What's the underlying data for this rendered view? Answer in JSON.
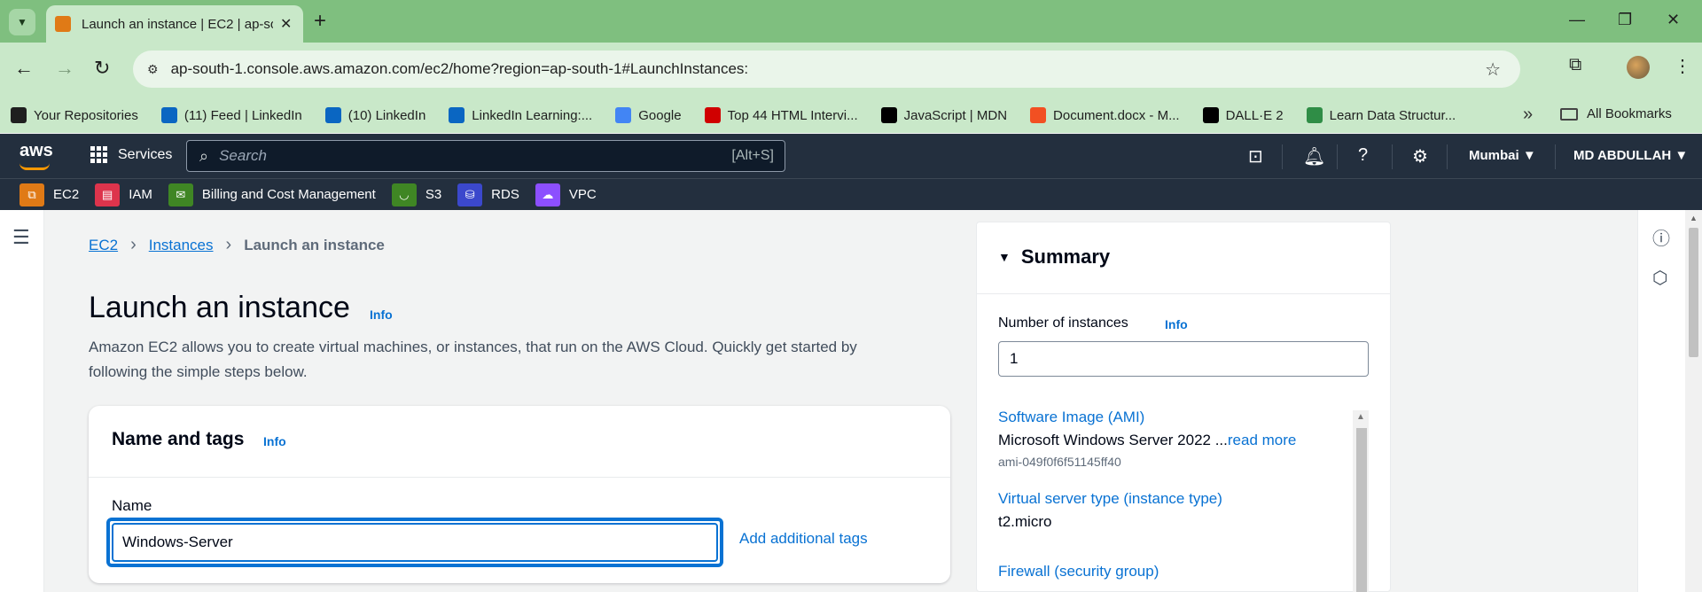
{
  "browser": {
    "tab_title": "Launch an instance | EC2 | ap-so",
    "url": "ap-south-1.console.aws.amazon.com/ec2/home?region=ap-south-1#LaunchInstances:",
    "bookmarks": [
      {
        "label": "Your Repositories",
        "color": "#1f1f1f"
      },
      {
        "label": "(11) Feed | LinkedIn",
        "color": "#0a66c2"
      },
      {
        "label": "(10) LinkedIn",
        "color": "#0a66c2"
      },
      {
        "label": "LinkedIn Learning:...",
        "color": "#0a66c2"
      },
      {
        "label": "Google",
        "color": "#4285f4"
      },
      {
        "label": "Top 44 HTML Intervi...",
        "color": "#d00000"
      },
      {
        "label": "JavaScript | MDN",
        "color": "#000000"
      },
      {
        "label": "Document.docx - M...",
        "color": "#f25022"
      },
      {
        "label": "DALL·E 2",
        "color": "#000000"
      },
      {
        "label": "Learn Data Structur...",
        "color": "#2f8d46"
      }
    ],
    "all_bookmarks": "All Bookmarks"
  },
  "aws": {
    "logo": "aws",
    "services": "Services",
    "search_placeholder": "Search",
    "search_shortcut": "[Alt+S]",
    "region": "Mumbai ▼",
    "user": "MD ABDULLAH ▼",
    "favorites": [
      {
        "label": "EC2",
        "color": "#e07a16"
      },
      {
        "label": "IAM",
        "color": "#dd344c"
      },
      {
        "label": "Billing and Cost Management",
        "color": "#3f8624"
      },
      {
        "label": "S3",
        "color": "#3f8624"
      },
      {
        "label": "RDS",
        "color": "#3b48cc"
      },
      {
        "label": "VPC",
        "color": "#8c4fff"
      }
    ]
  },
  "breadcrumb": {
    "items": [
      "EC2",
      "Instances"
    ],
    "current": "Launch an instance"
  },
  "page": {
    "title": "Launch an instance",
    "info": "Info",
    "description": "Amazon EC2 allows you to create virtual machines, or instances, that run on the AWS Cloud. Quickly get started by following the simple steps below."
  },
  "name_tags": {
    "heading": "Name and tags",
    "info": "Info",
    "name_label": "Name",
    "name_value": "Windows-Server",
    "add_tags": "Add additional tags"
  },
  "summary": {
    "heading": "Summary",
    "num_instances_label": "Number of instances",
    "info": "Info",
    "num_instances_value": "1",
    "ami_label": "Software Image (AMI)",
    "ami_value": "Microsoft Windows Server 2022 ...",
    "read_more": "read more",
    "ami_id": "ami-049f0f6f51145ff40",
    "instance_type_label": "Virtual server type (instance type)",
    "instance_type_value": "t2.micro",
    "firewall_label": "Firewall (security group)"
  }
}
